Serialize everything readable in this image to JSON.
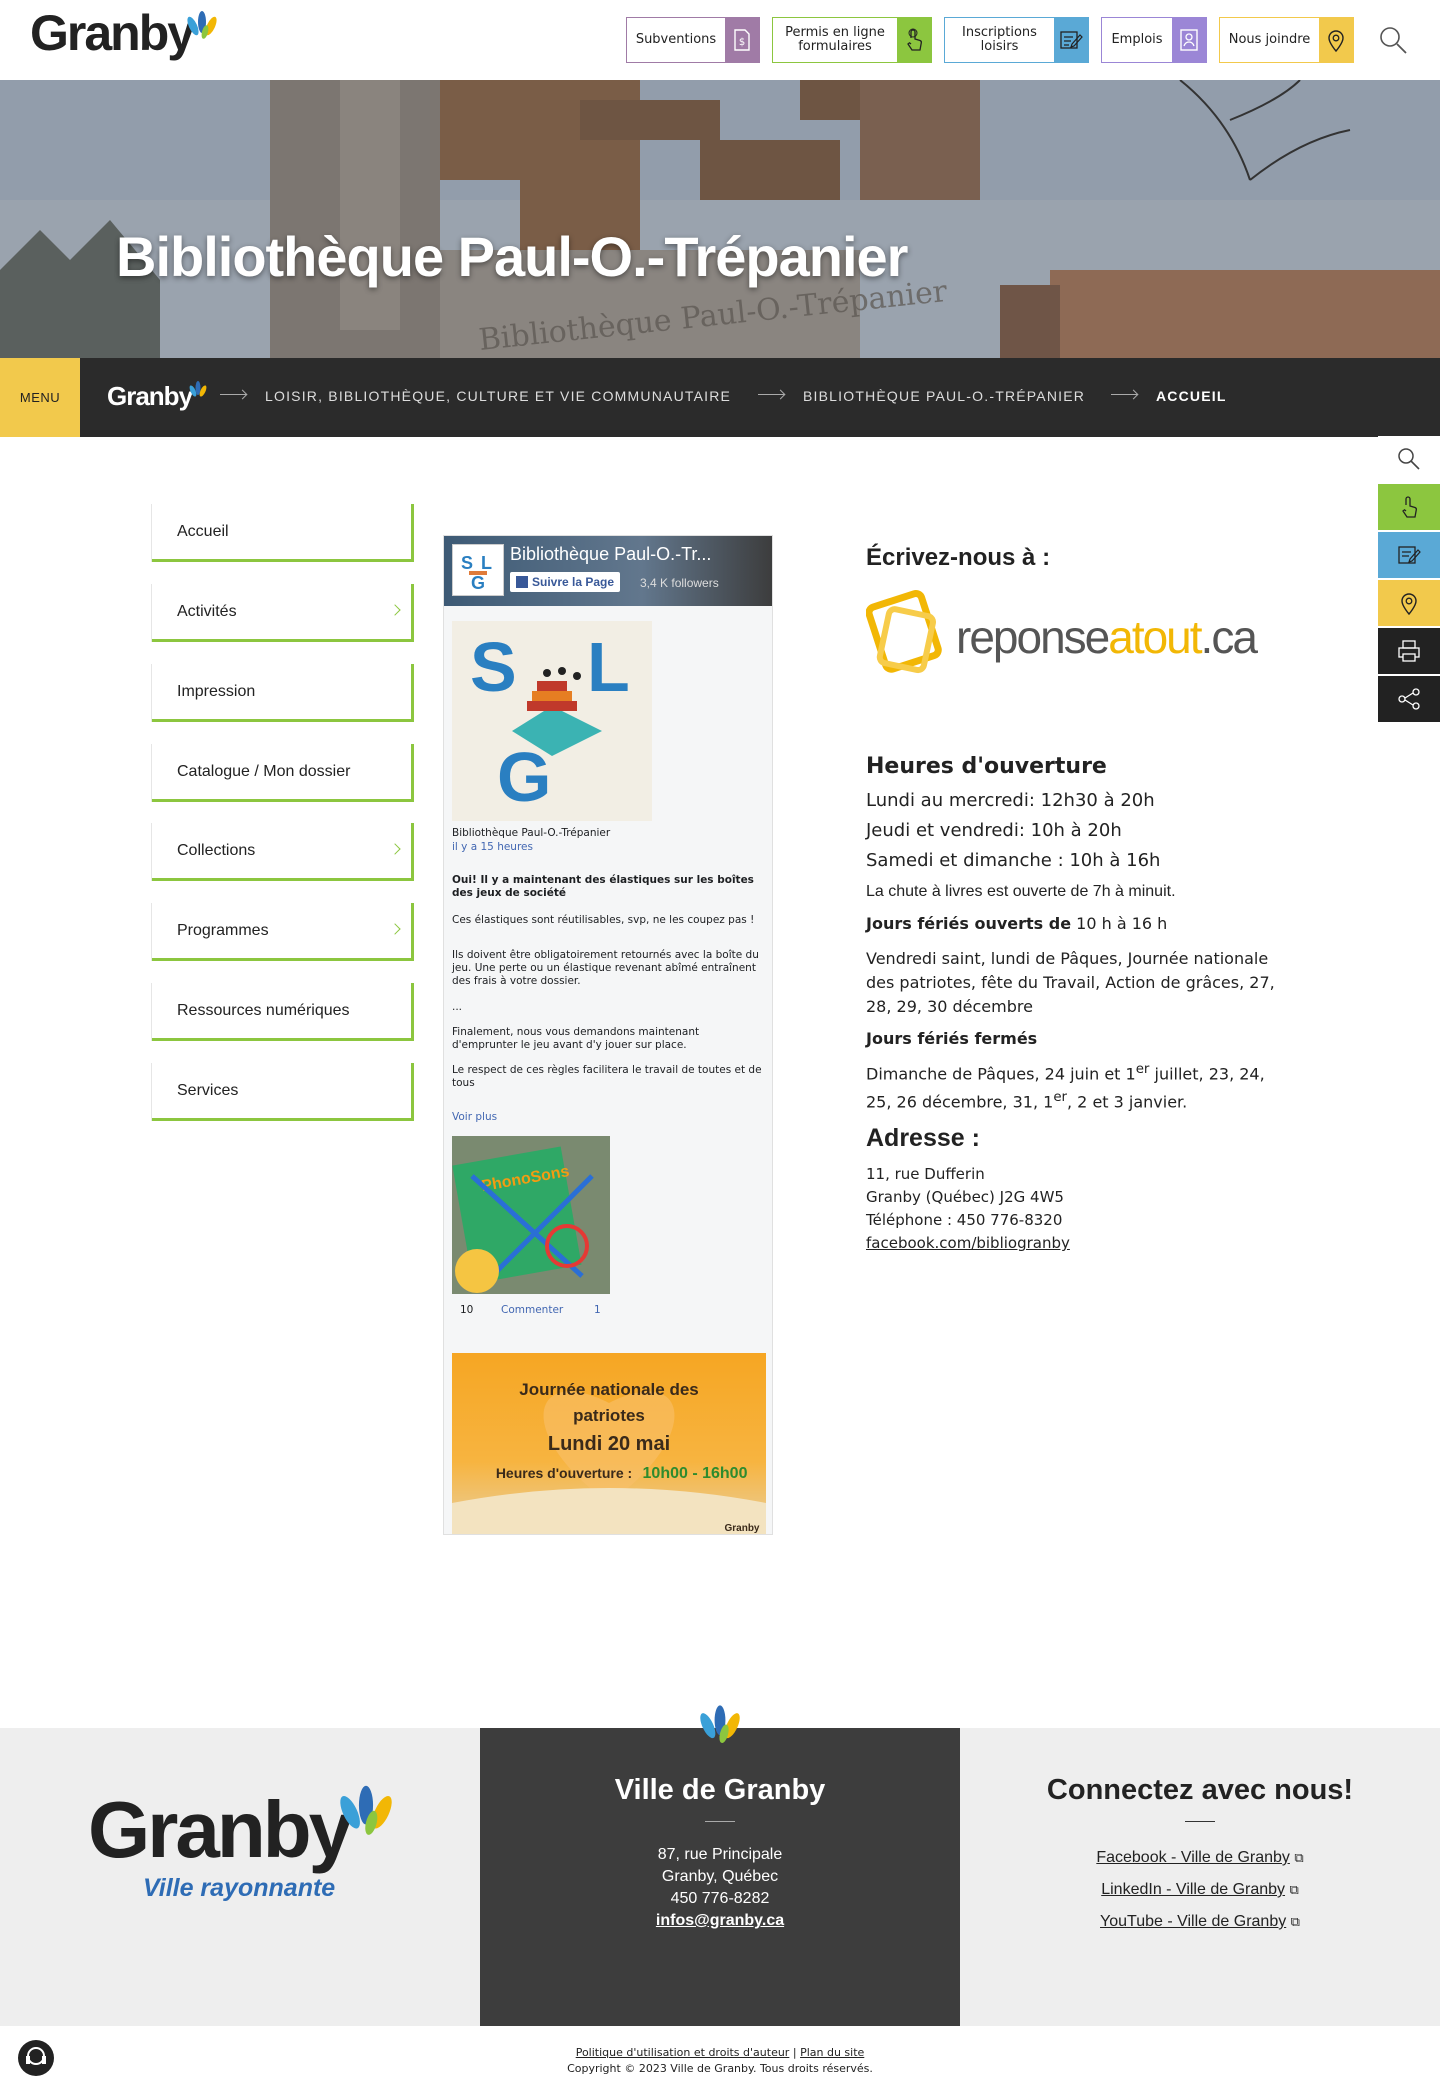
{
  "header": {
    "logo_text": "Granby",
    "buttons": [
      {
        "label": "Subventions",
        "icon": "document-dollar-icon",
        "color": "#a07ba6"
      },
      {
        "label": "Permis en ligne formulaires",
        "icon": "hand-click-icon",
        "color": "#8cc63f"
      },
      {
        "label": "Inscriptions loisirs",
        "icon": "edit-form-icon",
        "color": "#5aa9d6"
      },
      {
        "label": "Emplois",
        "icon": "contact-card-icon",
        "color": "#9b86d6"
      },
      {
        "label": "Nous joindre",
        "icon": "map-pin-icon",
        "color": "#f2c94c"
      }
    ],
    "search_icon": "search-icon"
  },
  "hero": {
    "title": "Bibliothèque Paul-O.-Trépanier",
    "sign_text": "Bibliothèque Paul-O.-Trépanier"
  },
  "breadcrumb": {
    "menu_label": "MENU",
    "home_logo": "Granby",
    "items": [
      "LOISIR, BIBLIOTHÈQUE, CULTURE ET VIE COMMUNAUTAIRE",
      "BIBLIOTHÈQUE PAUL-O.-TRÉPANIER",
      "ACCUEIL"
    ]
  },
  "sidebar": {
    "items": [
      {
        "label": "Accueil",
        "has_children": false
      },
      {
        "label": "Activités",
        "has_children": true
      },
      {
        "label": "Impression",
        "has_children": false
      },
      {
        "label": "Catalogue / Mon dossier",
        "has_children": false
      },
      {
        "label": "Collections",
        "has_children": true
      },
      {
        "label": "Programmes",
        "has_children": true
      },
      {
        "label": "Ressources numériques",
        "has_children": false
      },
      {
        "label": "Services",
        "has_children": false
      }
    ]
  },
  "facebook": {
    "page_name": "Bibliothèque Paul-O.-Tr...",
    "follow_label": "Suivre la Page",
    "followers": "3,4 K followers",
    "post_author": "Bibliothèque Paul-O.-Trépanier",
    "post_time": "il y a 15 heures",
    "post_title": "Oui! Il y a maintenant des élastiques sur les boîtes des jeux de société",
    "post_p1": "Ces élastiques sont réutilisables, svp, ne les coupez pas !",
    "post_p2": "Ils doivent être obligatoirement retournés avec la boîte du jeu. Une perte ou un élastique revenant abîmé entraînent des frais à votre dossier.",
    "post_p3": "...",
    "post_p4": "Finalement, nous vous demandons maintenant d'emprunter le jeu avant d'y jouer sur place.",
    "post_p5": "Le respect de ces règles facilitera le travail de toutes et de tous",
    "see_more": "Voir plus",
    "likes": "10",
    "comment_label": "Commenter",
    "shares": "1",
    "game_box_text": "PhonoSons",
    "poster_line1": "Journée nationale des",
    "poster_line2": "patriotes",
    "poster_line3": "Lundi 20 mai",
    "poster_line4": "Heures d'ouverture :",
    "poster_hours": "10h00 - 16h00",
    "poster_signature": "Granby"
  },
  "contact": {
    "write_title": "Écrivez-nous à :",
    "reponse_part1": "reponse",
    "reponse_part2": "atout",
    "reponse_part3": ".ca"
  },
  "hours": {
    "title": "Heures d'ouverture",
    "line1": "Lundi au mercredi: 12h30 à 20h",
    "line2": "Jeudi et vendredi: 10h à 20h",
    "line3": "Samedi et dimanche : 10h à 16h",
    "drop_box": "La chute à livres est ouverte de 7h à minuit.",
    "holidays_open_label": "Jours fériés ouverts de",
    "holidays_open_hours": "10 h à 16 h",
    "holidays_open_list": "Vendredi saint, lundi de Pâques, Journée nationale des patriotes, fête du Travail, Action de grâces, 27, 28, 29, 30 décembre",
    "holidays_closed_label": "Jours fériés fermés",
    "closed_a": "Dimanche de Pâques, 24 juin et 1",
    "closed_sup1": "er",
    "closed_b": " juillet, 23, 24, 25, 26 décembre, 31, 1",
    "closed_sup2": "er",
    "closed_c": ", 2 et 3 janvier."
  },
  "address": {
    "title": "Adresse :",
    "line1": "11, rue Dufferin",
    "line2": "Granby (Québec) J2G 4W5",
    "phone": "Téléphone : 450 776-8320",
    "facebook_link": "facebook.com/bibliogranby"
  },
  "right_sidebar": [
    {
      "icon": "search-icon",
      "color": "#ffffff"
    },
    {
      "icon": "hand-click-icon",
      "color": "#8cc63f"
    },
    {
      "icon": "edit-form-icon",
      "color": "#5aa9d6"
    },
    {
      "icon": "map-pin-icon",
      "color": "#f2c94c"
    },
    {
      "icon": "printer-icon",
      "color": "#222222"
    },
    {
      "icon": "share-icon",
      "color": "#222222"
    }
  ],
  "footer": {
    "logo_word": "Granby",
    "tagline": "Ville rayonnante",
    "city_title": "Ville de Granby",
    "street": "87, rue Principale",
    "city": "Granby, Québec",
    "phone": "450 776-8282",
    "email": "infos@granby.ca",
    "connect_title": "Connectez avec nous!",
    "social": [
      "Facebook - Ville de Granby",
      "LinkedIn - Ville de Granby",
      "YouTube - Ville de Granby"
    ],
    "policy_link": "Politique d'utilisation et droits d'auteur",
    "sitemap_link": "Plan du site",
    "separator": "|",
    "copyright": "Copyright © 2023 Ville de Granby. Tous droits réservés."
  }
}
